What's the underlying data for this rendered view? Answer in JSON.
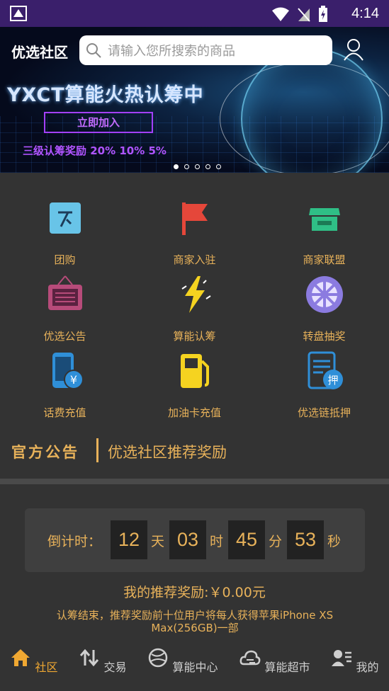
{
  "status_bar": {
    "time": "4:14"
  },
  "banner": {
    "logo": "优选社区",
    "search_placeholder": "请输入您所搜索的商品",
    "headline": "YXCT算能火热认筹中",
    "join_button": "立即加入",
    "reward_text": "三级认筹奖励 20% 10% 5%",
    "slide_count": 5,
    "active_slide": 1
  },
  "menu": [
    {
      "label": "团购",
      "icon": "group-buy-icon"
    },
    {
      "label": "商家入驻",
      "icon": "flag-icon"
    },
    {
      "label": "商家联盟",
      "icon": "store-icon"
    },
    {
      "label": "优选公告",
      "icon": "notice-board-icon"
    },
    {
      "label": "算能认筹",
      "icon": "lightning-icon"
    },
    {
      "label": "转盘抽奖",
      "icon": "wheel-icon"
    },
    {
      "label": "话费充值",
      "icon": "phone-topup-icon"
    },
    {
      "label": "加油卡充值",
      "icon": "fuel-pump-icon"
    },
    {
      "label": "优选链抵押",
      "icon": "pledge-document-icon"
    }
  ],
  "notice": {
    "tag": "官方公告",
    "text": "优选社区推荐奖励"
  },
  "countdown": {
    "label": "倒计时：",
    "days": "12",
    "day_unit": "天",
    "hours": "03",
    "hour_unit": "时",
    "minutes": "45",
    "minute_unit": "分",
    "seconds": "53",
    "second_unit": "秒"
  },
  "my_reward": "我的推荐奖励:￥0.00元",
  "reward_desc": "认筹结束，推荐奖励前十位用户将每人获得苹果iPhone XS Max(256GB)一部",
  "tabs": [
    {
      "label": "社区",
      "icon": "home-icon",
      "active": true
    },
    {
      "label": "交易",
      "icon": "swap-icon",
      "active": false
    },
    {
      "label": "算能中心",
      "icon": "globe-icon",
      "active": false
    },
    {
      "label": "算能超市",
      "icon": "cloud-icon",
      "active": false
    },
    {
      "label": "我的",
      "icon": "profile-icon",
      "active": false
    }
  ],
  "colors": {
    "accent": "#e8b25a",
    "active_tab": "#f0a832",
    "background": "#333333",
    "status_bar": "#3a1f6b"
  }
}
